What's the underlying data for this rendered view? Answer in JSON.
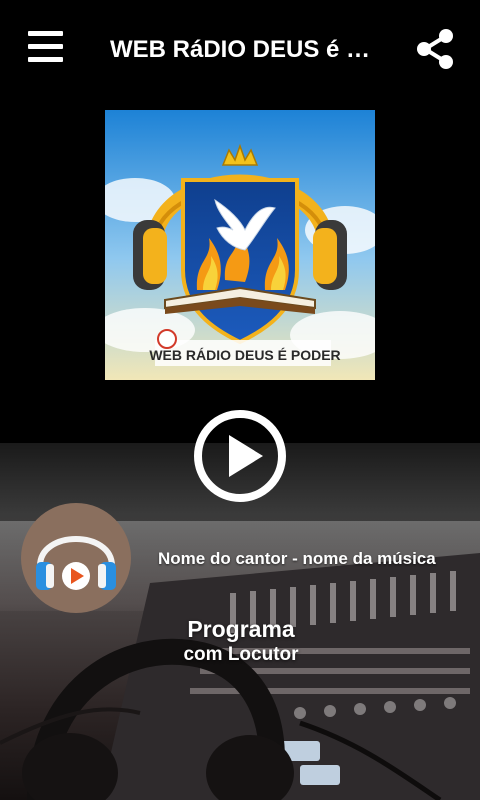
{
  "header": {
    "title": "WEB RáDIO DEUS é …",
    "menu_icon": "hamburger-menu-icon",
    "share_icon": "share-icon"
  },
  "logo": {
    "caption": "WEB RÁDIO DEUS É PODER"
  },
  "player": {
    "play_icon": "play-icon",
    "track": "Nome do cantor - nome da música",
    "program_title": "Programa",
    "program_host": "com Locutor"
  },
  "colors": {
    "background": "#000000",
    "text": "#ffffff",
    "avatar_bg": "#8a6f5e",
    "headphone_blue": "#2a8fe0",
    "play_orange": "#e8551e"
  }
}
